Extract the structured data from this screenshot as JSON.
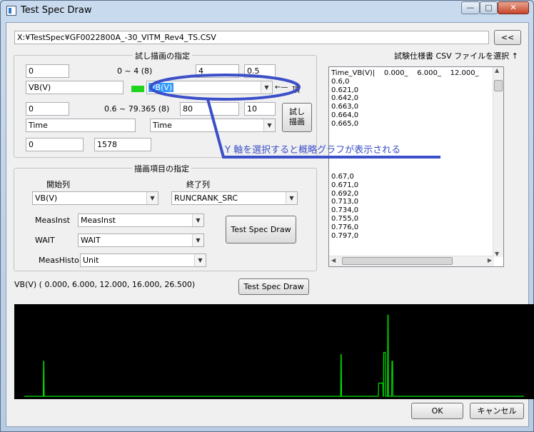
{
  "window": {
    "title": "Test Spec Draw",
    "min": "—",
    "max": "□",
    "close": "✕"
  },
  "file": {
    "path": "X:¥TestSpec¥GF0022800A_-30_VITM_Rev4_TS.CSV",
    "browse_label": "<<"
  },
  "trial": {
    "title": "試し描画の指定",
    "row1": {
      "left": "0",
      "range": "0 ~ 4 (8)",
      "mid": "4",
      "right": "0.5"
    },
    "y_text": "VB(V)",
    "y_combo": "VB(V)",
    "y_hint": "←—",
    "y_note": "項",
    "row2": {
      "left": "0",
      "range": "0.6 ~ 79.365 (8)",
      "mid": "80",
      "right": "10"
    },
    "x_text": "Time",
    "x_combo": "Time",
    "row3": {
      "left": "0",
      "right": "1578"
    },
    "draw_button": "試し\n描画"
  },
  "items": {
    "title": "描画項目の指定",
    "start_col_label": "開始列",
    "end_col_label": "終了列",
    "start_col": "VB(V)",
    "end_col": "RUNCRANK_SRC",
    "measinst_label": "MeasInst",
    "measinst": "MeasInst",
    "wait_label": "WAIT",
    "wait": "WAIT",
    "meashisto_label": "MeasHisto",
    "meashisto": "Unit",
    "test_spec_button": "Test Spec Draw"
  },
  "csv": {
    "select_label": "試験仕様書 CSV ファイルを選択 ↑",
    "lines_top": [
      "Time_VB(V)|    0.000_    6.000_    12.000_",
      "0.6,0",
      "0.621,0",
      "0.642,0",
      "0.663,0",
      "0.664,0",
      "0.665,0"
    ],
    "lines_bottom": [
      "0.67,0",
      "0.671,0",
      "0.692,0",
      "0.713,0",
      "0.734,0",
      "0.755,0",
      "0.776,0",
      "0.797,0"
    ]
  },
  "summary": {
    "text": "VB(V) (     0.000,     6.000,     12.000,     16.000,     26.500)",
    "button": "Test Spec Draw"
  },
  "annotation": {
    "text": "Y 軸を選択すると概略グラフが表示される",
    "color": "#3b4fc8"
  },
  "chart_data": {
    "type": "line",
    "color": "#00e000",
    "background": "#000000",
    "x": [
      0,
      60,
      61,
      62,
      63,
      999,
      1000,
      1001,
      1002,
      1118,
      1119,
      1132,
      1133,
      1134,
      1135,
      1140,
      1141,
      1147,
      1148,
      1149,
      1150,
      1160,
      1161,
      1163,
      1164,
      1170,
      1171,
      1578
    ],
    "y": [
      0,
      0,
      16,
      16,
      0,
      0,
      19,
      19,
      0,
      0,
      6,
      6,
      0,
      0,
      20,
      20,
      0,
      0,
      37,
      37,
      0,
      0,
      16,
      16,
      0,
      0,
      0,
      0
    ],
    "xlim": [
      0,
      1578
    ],
    "ylim": [
      0,
      40
    ]
  },
  "footer": {
    "ok": "OK",
    "cancel": "キャンセル"
  }
}
